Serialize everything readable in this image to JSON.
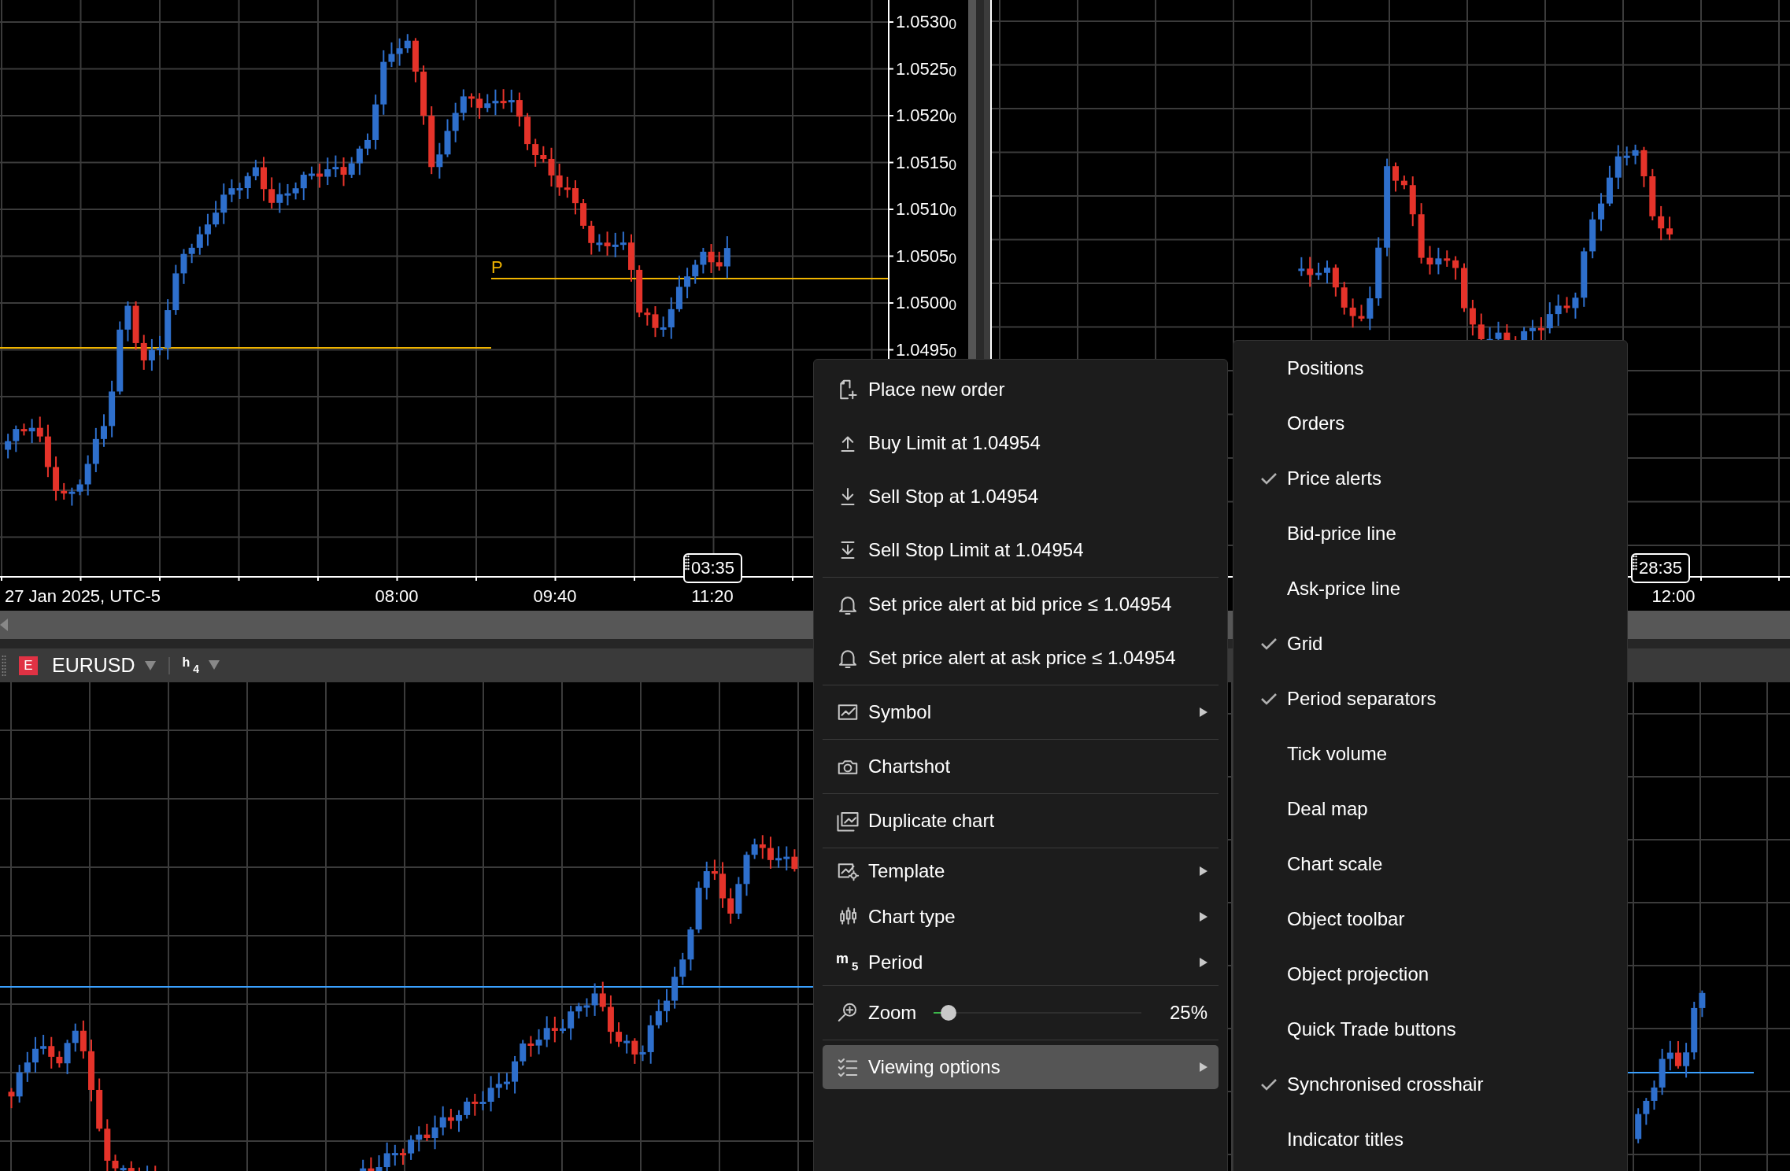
{
  "top_left_chart": {
    "price_axis": [
      "1.0530$_{0}$",
      "1.0525$_{0}$",
      "1.0520$_{0}$",
      "1.0515$_{0}$",
      "1.0510$_{0}$",
      "1.0505$_{0}$",
      "1.0500$_{0}$",
      "1.0495$_{0}$"
    ],
    "line_label": "P",
    "time_axis": [
      "27 Jan 2025, UTC-5",
      "08:00",
      "09:40",
      "11:20"
    ],
    "crosshair_time": "03:35"
  },
  "top_right_chart": {
    "time_axis": [
      "12:00"
    ],
    "crosshair_time": "28:35"
  },
  "symbol_bar": {
    "badge": "E",
    "symbol": "EURUSD",
    "period": "h",
    "period_sub": "4"
  },
  "context_menu": {
    "sections": [
      {
        "items": [
          {
            "kind": "action",
            "label": "Place new order",
            "selected": false
          },
          {
            "kind": "action",
            "label": "Buy Limit at 1.04954",
            "selected": false
          },
          {
            "kind": "action",
            "label": "Sell Stop at 1.04954",
            "selected": false
          },
          {
            "kind": "action",
            "label": "Sell Stop Limit at 1.04954",
            "selected": false
          }
        ]
      },
      {
        "items": [
          {
            "kind": "action",
            "label": "Set price alert at bid price ≤ 1.04954",
            "selected": false
          },
          {
            "kind": "action",
            "label": "Set price alert at ask price ≤ 1.04954",
            "selected": false
          }
        ]
      },
      {
        "items": [
          {
            "kind": "submenu",
            "label": "Symbol",
            "selected": false
          }
        ]
      },
      {
        "items": [
          {
            "kind": "action",
            "label": "Chartshot",
            "selected": false
          }
        ]
      },
      {
        "items": [
          {
            "kind": "action",
            "label": "Duplicate chart",
            "selected": false
          }
        ]
      },
      {
        "items": [
          {
            "kind": "submenu",
            "label": "Template",
            "selected": false
          },
          {
            "kind": "submenu",
            "label": "Chart type",
            "selected": false
          },
          {
            "kind": "submenu",
            "label": "Period",
            "icon_text": "m",
            "icon_sub": "5",
            "selected": false
          }
        ]
      },
      {
        "items": [
          {
            "kind": "slider",
            "label": "Zoom",
            "level": 0.07,
            "reading": "25%",
            "selected": false
          }
        ]
      },
      {
        "items": [
          {
            "kind": "submenu",
            "label": "Viewing options",
            "selected": true
          }
        ]
      }
    ]
  },
  "viewing_options": [
    {
      "label": "Positions",
      "checked": false
    },
    {
      "label": "Orders",
      "checked": false
    },
    {
      "label": "Price alerts",
      "checked": true
    },
    {
      "label": "Bid-price line",
      "checked": false
    },
    {
      "label": "Ask-price line",
      "checked": false
    },
    {
      "label": "Grid",
      "checked": true
    },
    {
      "label": "Period separators",
      "checked": true
    },
    {
      "label": "Tick volume",
      "checked": false
    },
    {
      "label": "Deal map",
      "checked": false
    },
    {
      "label": "Chart scale",
      "checked": false
    },
    {
      "label": "Object toolbar",
      "checked": false
    },
    {
      "label": "Object projection",
      "checked": false
    },
    {
      "label": "Quick Trade buttons",
      "checked": false
    },
    {
      "label": "Synchronised crosshair",
      "checked": true
    },
    {
      "label": "Indicator titles",
      "checked": false
    }
  ]
}
